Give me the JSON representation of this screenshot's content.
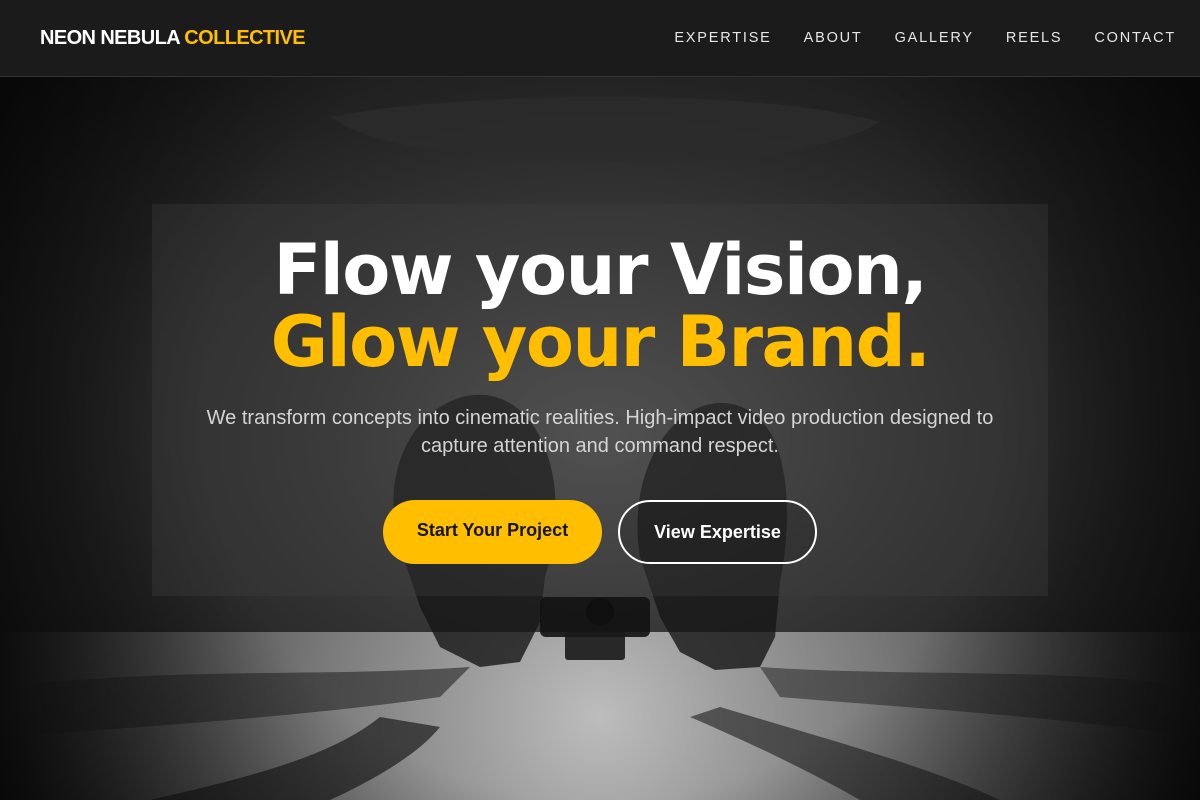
{
  "header": {
    "brand_main": "NEON NEBULA",
    "brand_accent": "COLLECTIVE",
    "nav": [
      "EXPERTISE",
      "ABOUT",
      "GALLERY",
      "REELS",
      "CONTACT"
    ]
  },
  "hero": {
    "title_line1": "Flow your Vision,",
    "title_line2": "Glow your Brand.",
    "subtitle": "We transform concepts into cinematic realities. High-impact video production designed to capture attention and command respect.",
    "primary_cta": "Start Your Project",
    "secondary_cta": "View Expertise"
  },
  "colors": {
    "accent": "#ffbf00",
    "background": "#141414",
    "header_bg": "#1b1b1b",
    "text": "#ffffff"
  }
}
